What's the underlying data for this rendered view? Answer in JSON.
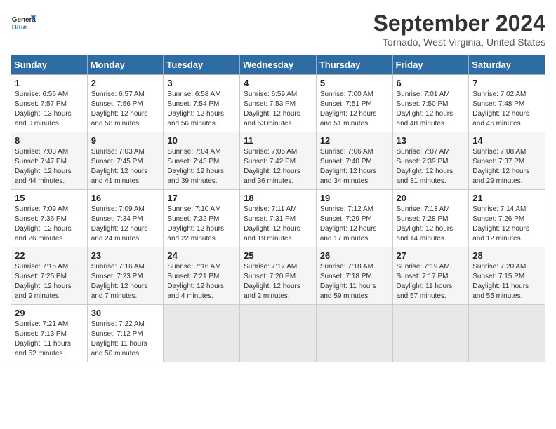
{
  "header": {
    "logo_line1": "General",
    "logo_line2": "Blue",
    "month": "September 2024",
    "location": "Tornado, West Virginia, United States"
  },
  "weekdays": [
    "Sunday",
    "Monday",
    "Tuesday",
    "Wednesday",
    "Thursday",
    "Friday",
    "Saturday"
  ],
  "weeks": [
    [
      {
        "day": "1",
        "info": "Sunrise: 6:56 AM\nSunset: 7:57 PM\nDaylight: 13 hours\nand 0 minutes."
      },
      {
        "day": "2",
        "info": "Sunrise: 6:57 AM\nSunset: 7:56 PM\nDaylight: 12 hours\nand 58 minutes."
      },
      {
        "day": "3",
        "info": "Sunrise: 6:58 AM\nSunset: 7:54 PM\nDaylight: 12 hours\nand 56 minutes."
      },
      {
        "day": "4",
        "info": "Sunrise: 6:59 AM\nSunset: 7:53 PM\nDaylight: 12 hours\nand 53 minutes."
      },
      {
        "day": "5",
        "info": "Sunrise: 7:00 AM\nSunset: 7:51 PM\nDaylight: 12 hours\nand 51 minutes."
      },
      {
        "day": "6",
        "info": "Sunrise: 7:01 AM\nSunset: 7:50 PM\nDaylight: 12 hours\nand 48 minutes."
      },
      {
        "day": "7",
        "info": "Sunrise: 7:02 AM\nSunset: 7:48 PM\nDaylight: 12 hours\nand 46 minutes."
      }
    ],
    [
      {
        "day": "8",
        "info": "Sunrise: 7:03 AM\nSunset: 7:47 PM\nDaylight: 12 hours\nand 44 minutes."
      },
      {
        "day": "9",
        "info": "Sunrise: 7:03 AM\nSunset: 7:45 PM\nDaylight: 12 hours\nand 41 minutes."
      },
      {
        "day": "10",
        "info": "Sunrise: 7:04 AM\nSunset: 7:43 PM\nDaylight: 12 hours\nand 39 minutes."
      },
      {
        "day": "11",
        "info": "Sunrise: 7:05 AM\nSunset: 7:42 PM\nDaylight: 12 hours\nand 36 minutes."
      },
      {
        "day": "12",
        "info": "Sunrise: 7:06 AM\nSunset: 7:40 PM\nDaylight: 12 hours\nand 34 minutes."
      },
      {
        "day": "13",
        "info": "Sunrise: 7:07 AM\nSunset: 7:39 PM\nDaylight: 12 hours\nand 31 minutes."
      },
      {
        "day": "14",
        "info": "Sunrise: 7:08 AM\nSunset: 7:37 PM\nDaylight: 12 hours\nand 29 minutes."
      }
    ],
    [
      {
        "day": "15",
        "info": "Sunrise: 7:09 AM\nSunset: 7:36 PM\nDaylight: 12 hours\nand 26 minutes."
      },
      {
        "day": "16",
        "info": "Sunrise: 7:09 AM\nSunset: 7:34 PM\nDaylight: 12 hours\nand 24 minutes."
      },
      {
        "day": "17",
        "info": "Sunrise: 7:10 AM\nSunset: 7:32 PM\nDaylight: 12 hours\nand 22 minutes."
      },
      {
        "day": "18",
        "info": "Sunrise: 7:11 AM\nSunset: 7:31 PM\nDaylight: 12 hours\nand 19 minutes."
      },
      {
        "day": "19",
        "info": "Sunrise: 7:12 AM\nSunset: 7:29 PM\nDaylight: 12 hours\nand 17 minutes."
      },
      {
        "day": "20",
        "info": "Sunrise: 7:13 AM\nSunset: 7:28 PM\nDaylight: 12 hours\nand 14 minutes."
      },
      {
        "day": "21",
        "info": "Sunrise: 7:14 AM\nSunset: 7:26 PM\nDaylight: 12 hours\nand 12 minutes."
      }
    ],
    [
      {
        "day": "22",
        "info": "Sunrise: 7:15 AM\nSunset: 7:25 PM\nDaylight: 12 hours\nand 9 minutes."
      },
      {
        "day": "23",
        "info": "Sunrise: 7:16 AM\nSunset: 7:23 PM\nDaylight: 12 hours\nand 7 minutes."
      },
      {
        "day": "24",
        "info": "Sunrise: 7:16 AM\nSunset: 7:21 PM\nDaylight: 12 hours\nand 4 minutes."
      },
      {
        "day": "25",
        "info": "Sunrise: 7:17 AM\nSunset: 7:20 PM\nDaylight: 12 hours\nand 2 minutes."
      },
      {
        "day": "26",
        "info": "Sunrise: 7:18 AM\nSunset: 7:18 PM\nDaylight: 11 hours\nand 59 minutes."
      },
      {
        "day": "27",
        "info": "Sunrise: 7:19 AM\nSunset: 7:17 PM\nDaylight: 11 hours\nand 57 minutes."
      },
      {
        "day": "28",
        "info": "Sunrise: 7:20 AM\nSunset: 7:15 PM\nDaylight: 11 hours\nand 55 minutes."
      }
    ],
    [
      {
        "day": "29",
        "info": "Sunrise: 7:21 AM\nSunset: 7:13 PM\nDaylight: 11 hours\nand 52 minutes."
      },
      {
        "day": "30",
        "info": "Sunrise: 7:22 AM\nSunset: 7:12 PM\nDaylight: 11 hours\nand 50 minutes."
      },
      {
        "day": "",
        "info": ""
      },
      {
        "day": "",
        "info": ""
      },
      {
        "day": "",
        "info": ""
      },
      {
        "day": "",
        "info": ""
      },
      {
        "day": "",
        "info": ""
      }
    ]
  ]
}
